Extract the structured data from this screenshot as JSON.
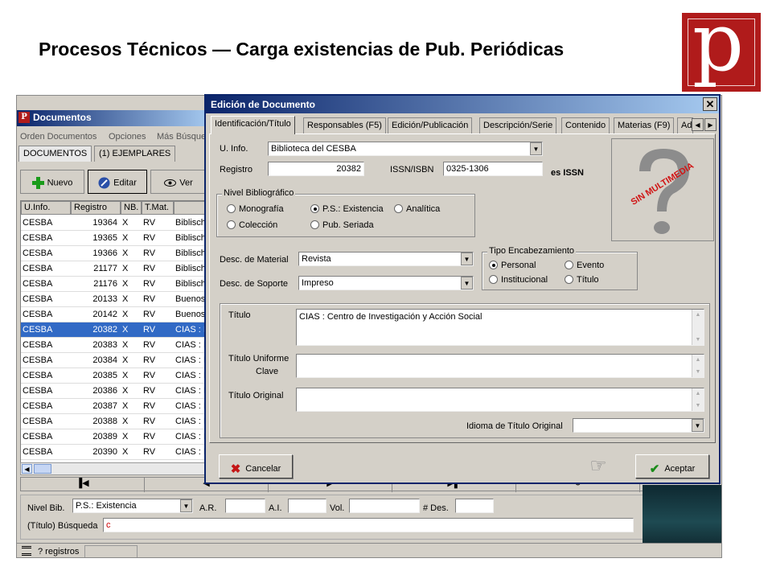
{
  "slide": {
    "title": "Procesos Técnicos — Carga existencias de Pub. Periódicas",
    "logo_letter": "p"
  },
  "app": {
    "title": "Documentos",
    "menu": [
      "Orden Documentos",
      "Opciones",
      "Más Búsque"
    ],
    "tabs": [
      "DOCUMENTOS",
      "(1) EJEMPLARES"
    ],
    "toolbar": {
      "new": "Nuevo",
      "edit": "Editar",
      "view": "Ver"
    },
    "grid": {
      "columns": [
        "U.Info.",
        "Registro",
        "NB.",
        "T.Mat."
      ],
      "rows": [
        [
          "CESBA",
          "19364",
          "X",
          "RV",
          "Biblisch"
        ],
        [
          "CESBA",
          "19365",
          "X",
          "RV",
          "Biblisch"
        ],
        [
          "CESBA",
          "19366",
          "X",
          "RV",
          "Biblisch"
        ],
        [
          "CESBA",
          "21177",
          "X",
          "RV",
          "Biblisch"
        ],
        [
          "CESBA",
          "21176",
          "X",
          "RV",
          "Biblisch"
        ],
        [
          "CESBA",
          "20133",
          "X",
          "RV",
          "Buenos"
        ],
        [
          "CESBA",
          "20142",
          "X",
          "RV",
          "Buenos"
        ],
        [
          "CESBA",
          "20382",
          "X",
          "RV",
          "CIAS : I"
        ],
        [
          "CESBA",
          "20383",
          "X",
          "RV",
          "CIAS : I"
        ],
        [
          "CESBA",
          "20384",
          "X",
          "RV",
          "CIAS : I"
        ],
        [
          "CESBA",
          "20385",
          "X",
          "RV",
          "CIAS : I"
        ],
        [
          "CESBA",
          "20386",
          "X",
          "RV",
          "CIAS : I"
        ],
        [
          "CESBA",
          "20387",
          "X",
          "RV",
          "CIAS : I"
        ],
        [
          "CESBA",
          "20388",
          "X",
          "RV",
          "CIAS : I"
        ],
        [
          "CESBA",
          "20389",
          "X",
          "RV",
          "CIAS : I"
        ],
        [
          "CESBA",
          "20390",
          "X",
          "RV",
          "CIAS : I"
        ]
      ],
      "selected_row": 7
    },
    "search": {
      "nivel_label": "Nivel Bib.",
      "nivel_value": "P.S.: Existencia",
      "ar_label": "A.R.",
      "ai_label": "A.I.",
      "vol_label": "Vol.",
      "des_label": "# Des.",
      "busqueda_label": "(Título) Búsqueda",
      "busqueda_value": "c"
    },
    "status": {
      "count": "? registros"
    }
  },
  "dialog": {
    "title": "Edición de Documento",
    "tabs": [
      "Identificación/Título",
      "Responsables (F5)",
      "Edición/Publicación",
      "Descripción/Serie",
      "Contenido",
      "Materias (F9)",
      "Ad"
    ],
    "uinfo_label": "U. Info.",
    "uinfo_value": "Biblioteca del CESBA",
    "registro_label": "Registro",
    "registro_value": "20382",
    "issn_label": "ISSN/ISBN",
    "issn_value": "0325-1306",
    "issn_note": "es ISSN",
    "nivel_group": "Nivel Bibliográfico",
    "nivel_options": [
      "Monografía",
      "P.S.: Existencia",
      "Analítica",
      "Colección",
      "Pub. Seriada"
    ],
    "nivel_selected": "P.S.: Existencia",
    "material_label": "Desc. de Material",
    "material_value": "Revista",
    "soporte_label": "Desc. de Soporte",
    "soporte_value": "Impreso",
    "encab_group": "Tipo Encabezamiento",
    "encab_options": [
      "Personal",
      "Evento",
      "Institucional",
      "Título"
    ],
    "encab_selected": "Personal",
    "titulo_label": "Título",
    "titulo_value": "CIAS : Centro de Investigación y Acción Social",
    "titulo_uniforme_label": "Título Uniforme",
    "clave_label": "Clave",
    "titulo_original_label": "Título Original",
    "idioma_label": "Idioma de Título Original",
    "idioma_value": "",
    "media_text": "SIN MULTIMEDIA",
    "cancel_label": "Cancelar",
    "accept_label": "Aceptar"
  }
}
